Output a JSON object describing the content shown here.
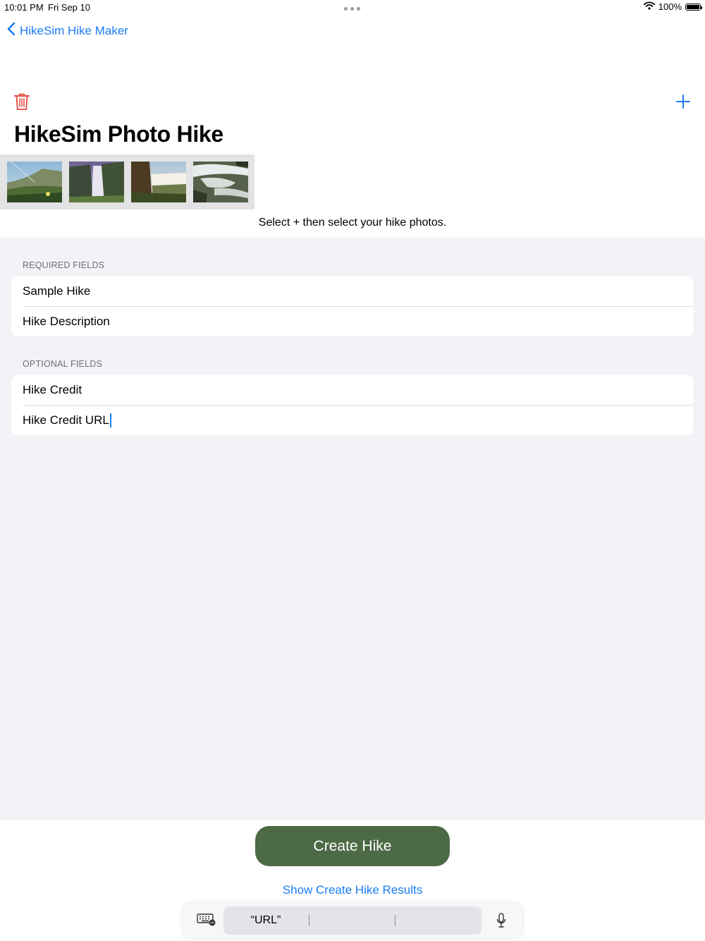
{
  "status_bar": {
    "time": "10:01 PM",
    "date": "Fri Sep 10",
    "battery": "100%"
  },
  "nav": {
    "back_label": "HikeSim Hike Maker"
  },
  "page": {
    "title": "HikeSim Photo Hike",
    "hint": "Select + then select your hike photos."
  },
  "photos": [
    "meadow-photo",
    "waterfall-photo",
    "falls-photo",
    "cascade-photo"
  ],
  "required": {
    "header": "REQUIRED FIELDS",
    "fields": [
      {
        "value": "Sample Hike"
      },
      {
        "value": "Hike Description"
      }
    ]
  },
  "optional": {
    "header": "OPTIONAL FIELDS",
    "fields": [
      {
        "value": "Hike Credit"
      },
      {
        "value": "Hike Credit URL"
      }
    ]
  },
  "actions": {
    "create": "Create Hike",
    "results": "Show Create Hike Results"
  },
  "keyboard_bar": {
    "suggestions": [
      "“URL”",
      "",
      ""
    ]
  },
  "colors": {
    "accent": "#1a7cf5",
    "button": "#4b6a45",
    "delete": "#e5483e",
    "background": "#f2f2f7"
  },
  "icons": [
    "chevron-left-icon",
    "trash-icon",
    "plus-icon",
    "wifi-icon",
    "battery-icon",
    "keyboard-icon",
    "microphone-icon"
  ]
}
